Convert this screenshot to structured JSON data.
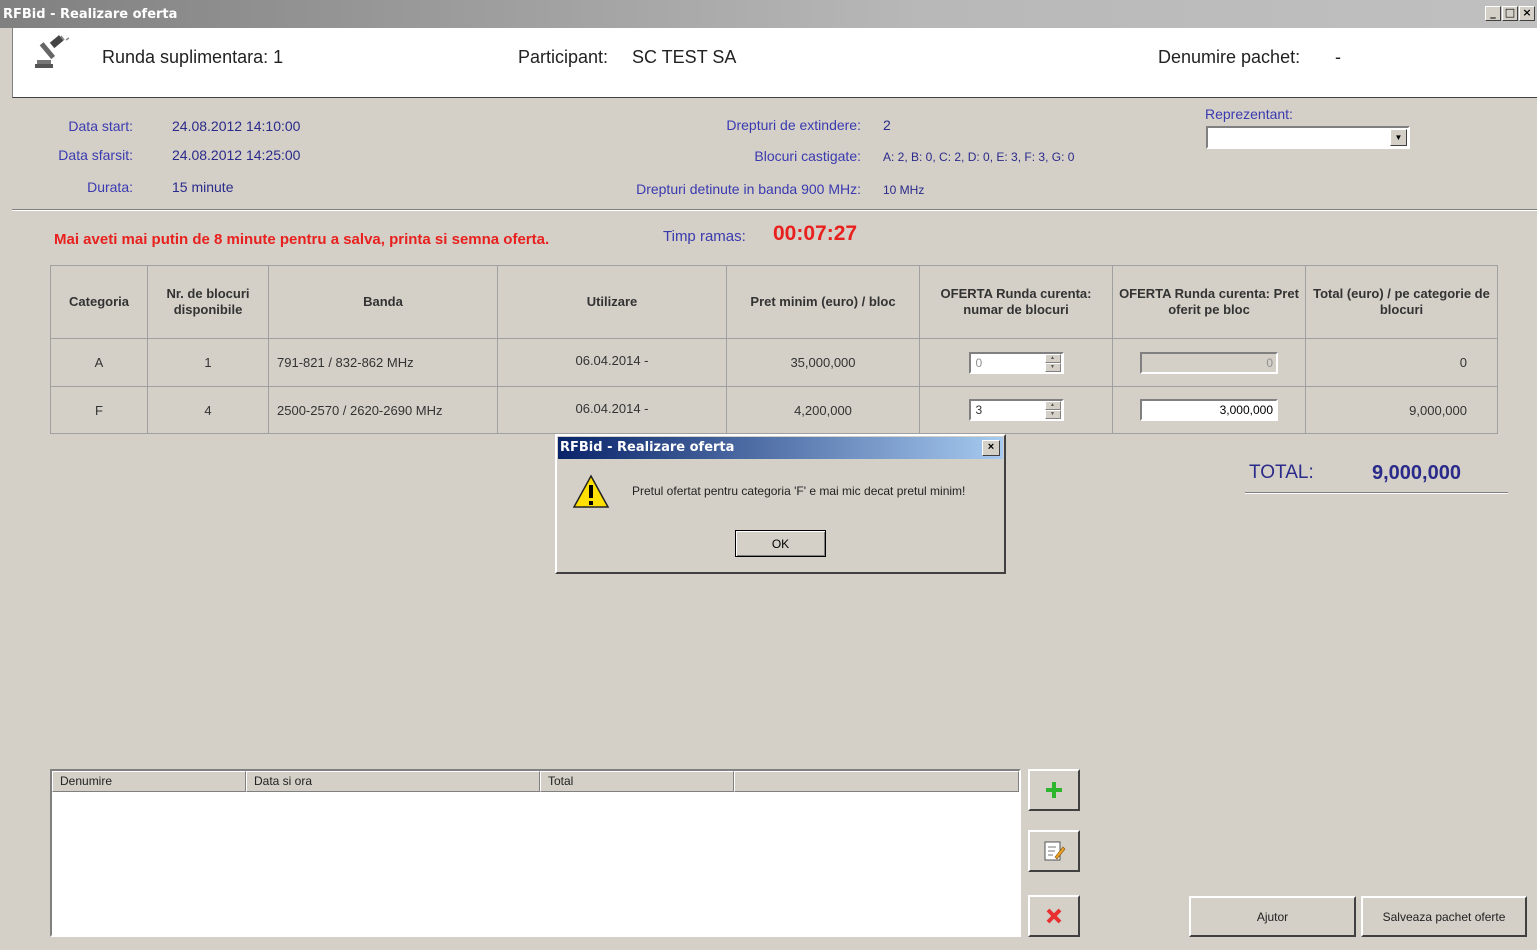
{
  "window": {
    "title": "RFBid - Realizare oferta",
    "min": "_",
    "max": "□",
    "close": "×"
  },
  "header": {
    "runda": "Runda suplimentara: 1",
    "participant_label": "Participant:",
    "participant_value": "SC TEST SA",
    "pachet_label": "Denumire pachet:",
    "pachet_value": "-"
  },
  "info": {
    "data_start_label": "Data start:",
    "data_start_value": "24.08.2012 14:10:00",
    "data_sfarsit_label": "Data sfarsit:",
    "data_sfarsit_value": "24.08.2012 14:25:00",
    "durata_label": "Durata:",
    "durata_value": "15 minute",
    "drepturi_ext_label": "Drepturi de extindere:",
    "drepturi_ext_value": "2",
    "blocuri_label": "Blocuri castigate:",
    "blocuri_value": "A: 2, B: 0, C: 2, D: 0, E: 3, F: 3, G: 0",
    "drepturi_900_label": "Drepturi detinute in banda 900 MHz:",
    "drepturi_900_value": "10 MHz",
    "reprezentant_label": "Reprezentant:",
    "reprezentant_value": ""
  },
  "status": {
    "warning": "Mai aveti mai putin de 8 minute pentru a salva, printa si semna oferta.",
    "timp_label": "Timp ramas:",
    "timp_value": "00:07:27"
  },
  "table": {
    "headers": [
      "Categoria",
      "Nr. de blocuri disponibile",
      "Banda",
      "Utilizare",
      "Pret minim (euro) / bloc",
      "OFERTA Runda curenta: numar de blocuri",
      "OFERTA Runda curenta: Pret oferit pe bloc",
      "Total (euro) / pe categorie de blocuri"
    ],
    "rows": [
      {
        "categoria": "A",
        "nr": "1",
        "banda": "791-821 / 832-862 MHz",
        "utilizare": "06.04.2014 -",
        "pret": "35,000,000",
        "numar": "0",
        "pret_oferit": "0",
        "total": "0"
      },
      {
        "categoria": "F",
        "nr": "4",
        "banda": "2500-2570 / 2620-2690 MHz",
        "utilizare": "06.04.2014 -",
        "pret": "4,200,000",
        "numar": "3",
        "pret_oferit": "3,000,000",
        "total": "9,000,000"
      }
    ]
  },
  "total": {
    "label": "TOTAL:",
    "value": "9,000,000"
  },
  "list": {
    "columns": [
      "Denumire",
      "Data si ora",
      "Total",
      ""
    ]
  },
  "buttons": {
    "ajutor": "Ajutor",
    "salveaza": "Salveaza pachet oferte"
  },
  "dialog": {
    "title": "RFBid - Realizare oferta",
    "close": "×",
    "message": "Pretul ofertat pentru categoria 'F' e mai mic decat pretul minim!",
    "ok": "OK"
  },
  "colors": {
    "warning": "#e8201e",
    "label_blue": "#3a3ab0",
    "dialog_title": "#0a246a"
  }
}
